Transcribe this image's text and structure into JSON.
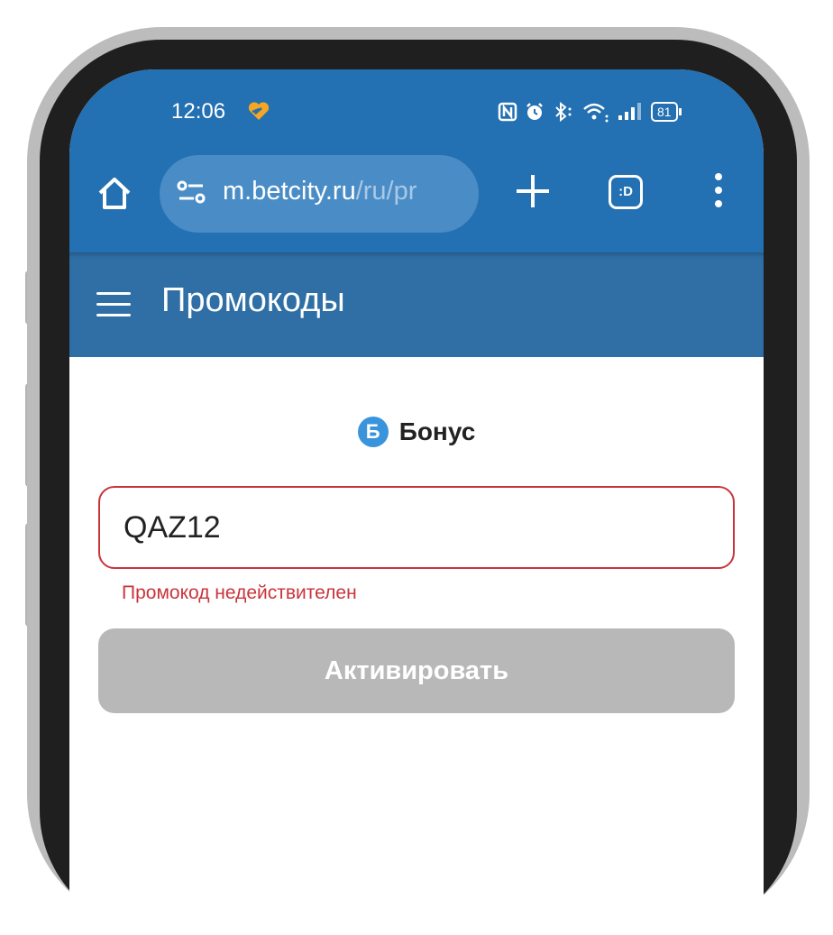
{
  "status_bar": {
    "time": "12:06",
    "battery": "81"
  },
  "browser": {
    "url_host": "m.betcity.ru",
    "url_path": "/ru/pr",
    "tabs_label": ":D"
  },
  "header": {
    "title": "Промокоды"
  },
  "promo": {
    "brand_letter": "Б",
    "brand_name": "Бонус",
    "input_value": "QAZ12",
    "error_message": "Промокод недействителен",
    "activate_label": "Активировать"
  },
  "colors": {
    "primary": "#2370b2",
    "header": "#2f6fa6",
    "error": "#c9343c",
    "button_disabled": "#b8b8b8",
    "brand_logo": "#3a94dc"
  },
  "icons": [
    "heart-icon",
    "nfc-icon",
    "alarm-icon",
    "bluetooth-icon",
    "wifi-icon",
    "signal-icon",
    "battery-icon",
    "home-icon",
    "site-settings-icon",
    "plus-icon",
    "tabs-icon",
    "more-vert-icon",
    "hamburger-icon"
  ]
}
